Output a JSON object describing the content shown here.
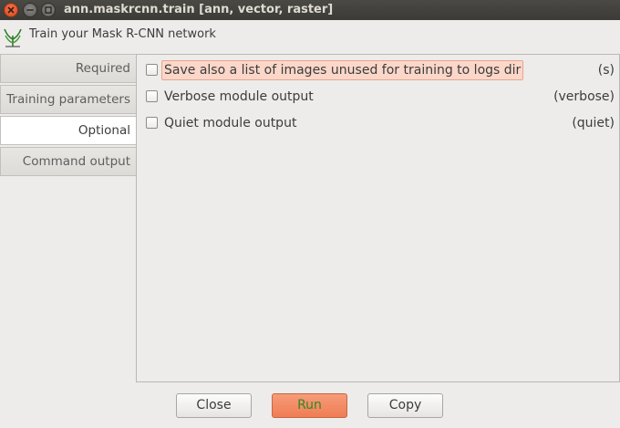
{
  "window": {
    "title": "ann.maskrcnn.train [ann, vector, raster]"
  },
  "header": {
    "description": "Train your Mask R-CNN network",
    "logo_icon": "grass-gis-logo-icon"
  },
  "tabs": [
    {
      "label": "Required",
      "active": false
    },
    {
      "label": "Training parameters",
      "active": false
    },
    {
      "label": "Optional",
      "active": true
    },
    {
      "label": "Command output",
      "active": false
    }
  ],
  "options": [
    {
      "label": "Save also a list of images unused for training to logs dir",
      "flag": "(s)",
      "checked": false,
      "highlighted": true
    },
    {
      "label": "Verbose module output",
      "flag": "(verbose)",
      "checked": false,
      "highlighted": false
    },
    {
      "label": "Quiet module output",
      "flag": "(quiet)",
      "checked": false,
      "highlighted": false
    }
  ],
  "buttons": {
    "close": "Close",
    "run": "Run",
    "copy": "Copy"
  },
  "colors": {
    "titlebar": "#3c3b37",
    "close_button": "#e9541f",
    "run_button": "#ee7d55",
    "run_text": "#2f8a1f",
    "highlight": "#fbd7c9"
  }
}
